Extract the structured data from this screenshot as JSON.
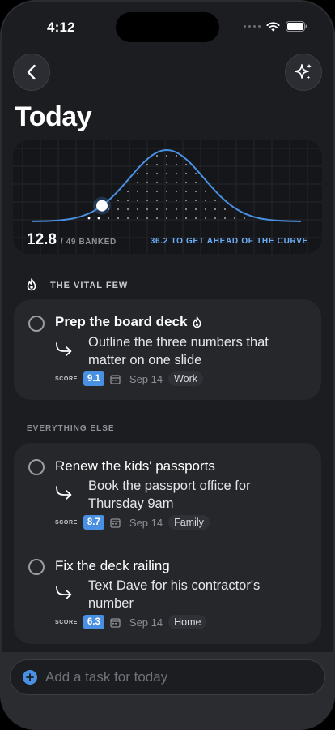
{
  "status_bar": {
    "time": "4:12"
  },
  "header": {
    "title": "Today",
    "back_icon": "chevron-left-icon",
    "action_icon": "sparkles-icon"
  },
  "curve": {
    "banked": "12.8",
    "banked_suffix": "/ 49 BANKED",
    "ahead_text": "36.2 TO GET AHEAD OF THE CURVE",
    "accent": "#4a90e2"
  },
  "sections": {
    "vital": "THE VITAL FEW",
    "else": "EVERYTHING ELSE"
  },
  "tasks": [
    {
      "title": "Prep the board deck",
      "subtask": "Outline the three numbers that matter on one slide",
      "score_label": "SCORE",
      "score": "9.1",
      "date": "Sep 14",
      "tag": "Work",
      "flame": true
    },
    {
      "title": "Renew the kids' passports",
      "subtask": "Book the passport office for Thursday 9am",
      "score_label": "SCORE",
      "score": "8.7",
      "date": "Sep 14",
      "tag": "Family"
    },
    {
      "title": "Fix the deck railing",
      "subtask": "Text Dave for his contractor's number",
      "score_label": "SCORE",
      "score": "6.3",
      "date": "Sep 14",
      "tag": "Home"
    }
  ],
  "composer": {
    "placeholder": "Add a task for today"
  }
}
